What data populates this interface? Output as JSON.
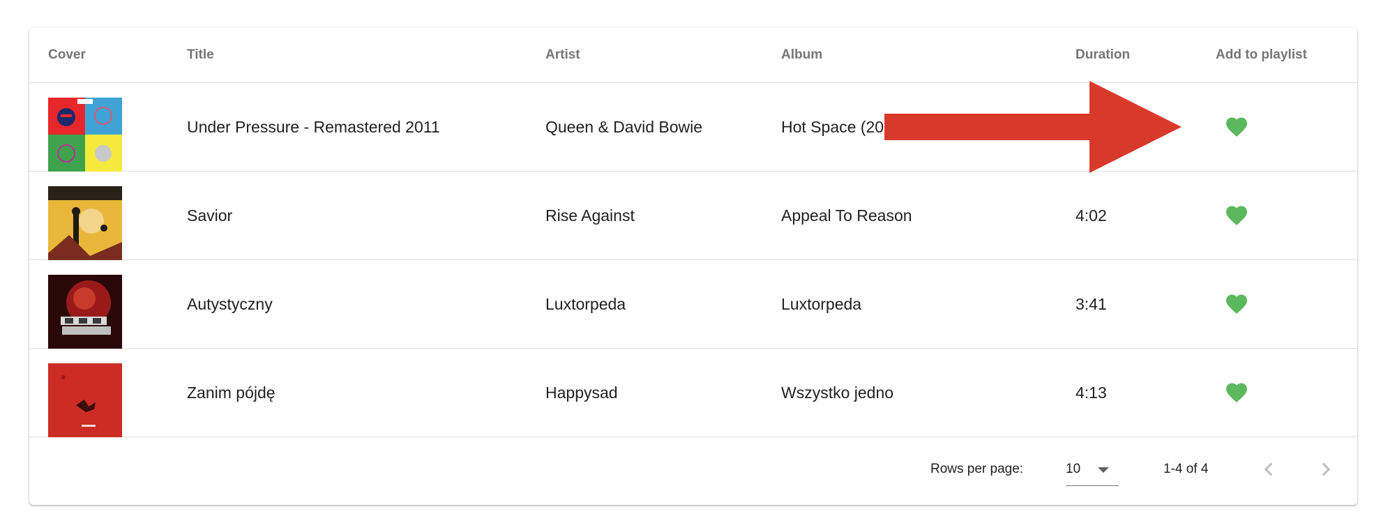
{
  "table": {
    "columns": {
      "cover": "Cover",
      "title": "Title",
      "artist": "Artist",
      "album": "Album",
      "duration": "Duration",
      "add": "Add to playlist"
    },
    "rows": [
      {
        "title": "Under Pressure - Remastered 2011",
        "artist": "Queen & David Bowie",
        "album": "Hot Space (20",
        "duration": "",
        "cover_icon": "album-cover-queen"
      },
      {
        "title": "Savior",
        "artist": "Rise Against",
        "album": "Appeal To Reason",
        "duration": "4:02",
        "cover_icon": "album-cover-rise-against"
      },
      {
        "title": "Autystyczny",
        "artist": "Luxtorpeda",
        "album": "Luxtorpeda",
        "duration": "3:41",
        "cover_icon": "album-cover-luxtorpeda"
      },
      {
        "title": "Zanim pójdę",
        "artist": "Happysad",
        "album": "Wszystko jedno",
        "duration": "4:13",
        "cover_icon": "album-cover-happysad"
      }
    ]
  },
  "footer": {
    "rows_per_page_label": "Rows per page:",
    "rows_per_page_value": "10",
    "range_label": "1-4 of 4"
  },
  "colors": {
    "heart": "#5cb85c",
    "annotation_arrow": "#d9392a",
    "header_text": "#757575",
    "divider": "#e0e0e0"
  },
  "icons": {
    "add_to_playlist": "heart-icon",
    "rows_dropdown": "caret-down-icon",
    "prev_page": "chevron-left-icon",
    "next_page": "chevron-right-icon",
    "annotation": "right-arrow-annotation"
  }
}
